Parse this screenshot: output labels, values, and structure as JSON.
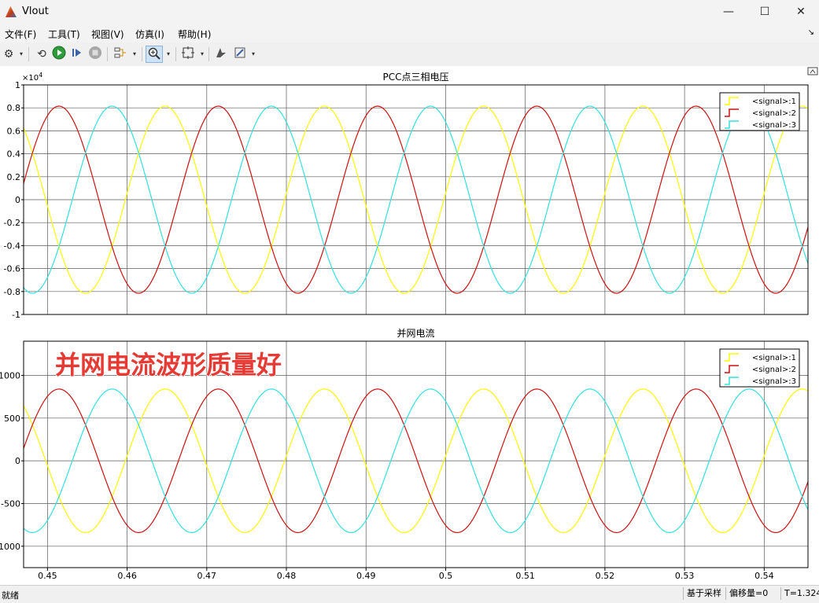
{
  "window": {
    "title": "Vlout",
    "minimize": "—",
    "maximize": "☐",
    "close": "✕"
  },
  "menu": [
    "文件(F)",
    "工具(T)",
    "视图(V)",
    "仿真(I)",
    "帮助(H)"
  ],
  "toolbar_icons": [
    "gear-icon",
    "restore-icon",
    "run-icon",
    "step-icon",
    "stop-icon",
    "signal-select-icon",
    "zoom-in-icon",
    "fit-axes-icon",
    "cursor-icon",
    "style-icon"
  ],
  "plots": [
    {
      "title": "PCC点三相电压",
      "exponent_label": "×10",
      "exponent_power": "4",
      "yticks": [
        1,
        0.8,
        0.6,
        0.4,
        0.2,
        0,
        -0.2,
        -0.4,
        -0.6,
        -0.8,
        -1
      ],
      "ytick_labels": [
        "1",
        "0.8",
        "0.6",
        "0.4",
        "0.2",
        "0",
        "-0.2",
        "-0.4",
        "-0.6",
        "-0.8",
        "-1"
      ],
      "ylim": [
        -1,
        1
      ],
      "amplitude": 0.815,
      "legend": [
        "<signal>:1",
        "<signal>:2",
        "<signal>:3"
      ],
      "annotation": ""
    },
    {
      "title": "并网电流",
      "yticks": [
        1000,
        500,
        0,
        -500,
        -1000
      ],
      "ytick_labels": [
        "1000",
        "500",
        "0",
        "-500",
        "-1000"
      ],
      "ylim": [
        -1250,
        1400
      ],
      "amplitude": 840,
      "legend": [
        "<signal>:1",
        "<signal>:2",
        "<signal>:3"
      ],
      "annotation": "并网电流波形质量好"
    }
  ],
  "chart_data": {
    "type": "line",
    "x_range": [
      0.447,
      0.5455
    ],
    "xticks": [
      0.45,
      0.46,
      0.47,
      0.48,
      0.49,
      0.5,
      0.51,
      0.52,
      0.53,
      0.54
    ],
    "xtick_labels": [
      "0.45",
      "0.46",
      "0.47",
      "0.48",
      "0.49",
      "0.5",
      "0.51",
      "0.52",
      "0.53",
      "0.54"
    ],
    "frequency_hz": 50,
    "series": [
      {
        "name": "<signal>:1",
        "color": "#ffff00",
        "phase_deg": 130
      },
      {
        "name": "<signal>:2",
        "color": "#cc1111",
        "phase_deg": 10
      },
      {
        "name": "<signal>:3",
        "color": "#33e0e0",
        "phase_deg": 250
      }
    ],
    "grid": true,
    "legend_position": "top-right"
  },
  "status": {
    "left": "就绪",
    "mode": "基于采样",
    "offset": "偏移量=0",
    "time": "T=1.324"
  }
}
